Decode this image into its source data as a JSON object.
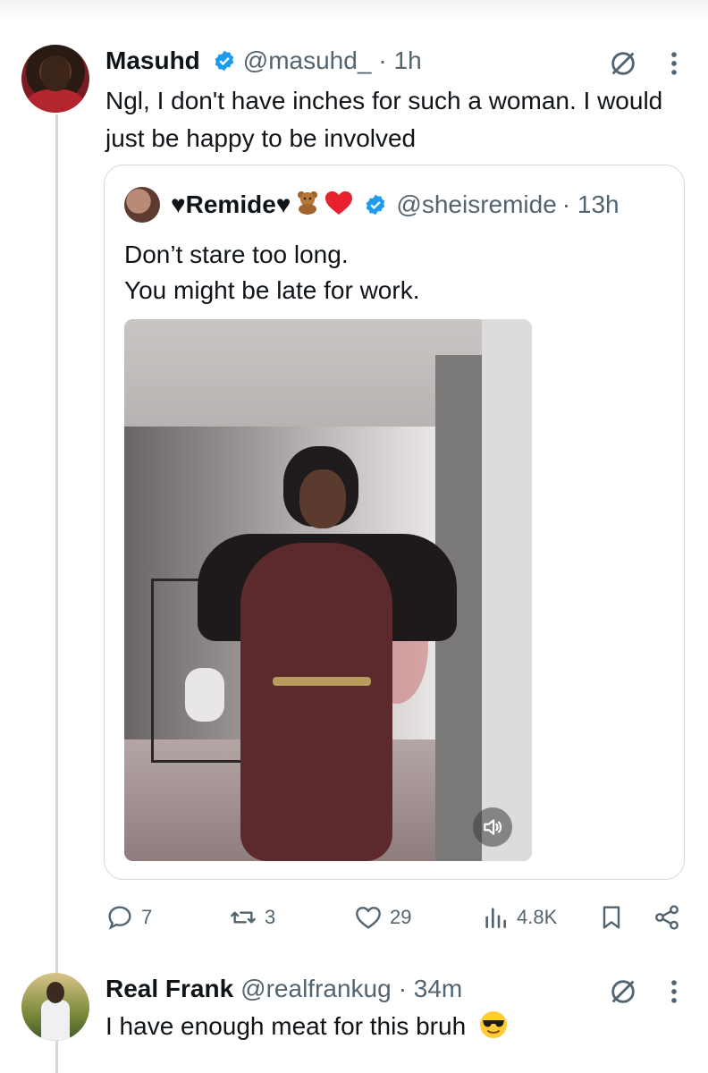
{
  "colors": {
    "accent": "#1d9bf0",
    "text": "#0f1419",
    "muted": "#536471",
    "border": "#cfd9de",
    "like_heart": "#536471"
  },
  "reply1": {
    "author_name": "Masuhd",
    "handle": "@masuhd_",
    "time": "· 1h",
    "text": "Ngl, I don't have inches for such a woman. I would just be happy to be involved",
    "quote": {
      "author_name": "♥Remide♥",
      "handle": "@sheisremide",
      "time": "· 13h",
      "text_line1": "Don’t stare too long.",
      "text_line2": "You might be late for work.",
      "media_icon": "volume-icon"
    },
    "actions": {
      "replies": "7",
      "reposts": "3",
      "likes": "29",
      "views": "4.8K"
    }
  },
  "reply2": {
    "author_name": "Real Frank",
    "handle": "@realfrankug",
    "time": "· 34m",
    "text": "I have enough meat for this bruh"
  }
}
